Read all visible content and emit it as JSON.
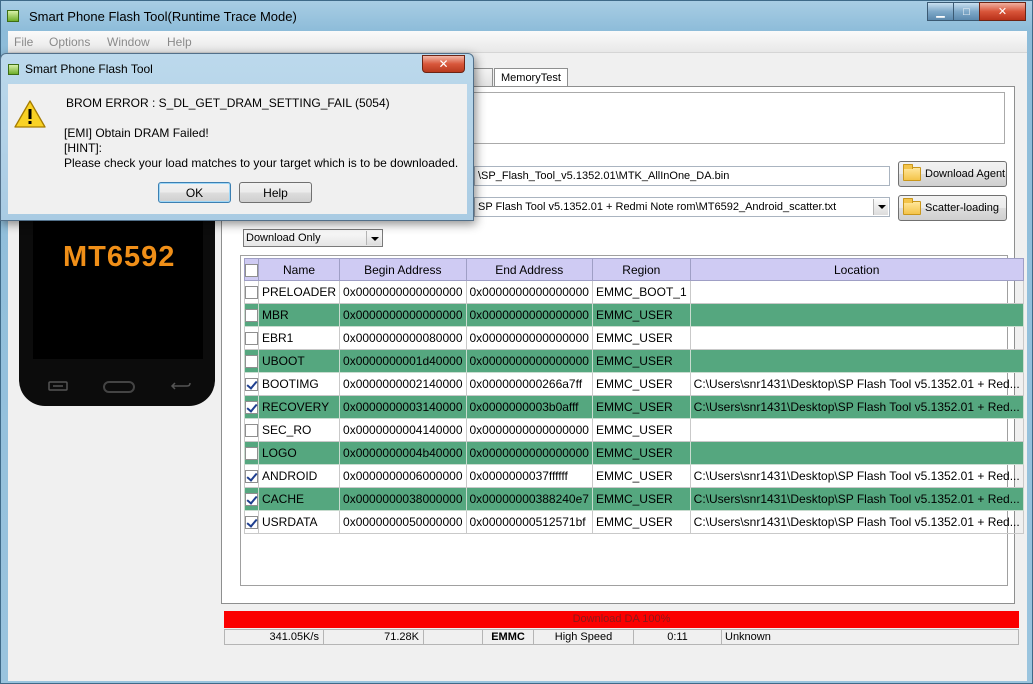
{
  "app": {
    "title": "Smart Phone Flash Tool(Runtime Trace Mode)"
  },
  "window_controls": {
    "minimize": "▁",
    "maximize": "□",
    "close": "✕"
  },
  "menu": [
    "File",
    "Options",
    "Window",
    "Help"
  ],
  "tabs": {
    "partial_label": "k",
    "memory_test_label": "MemoryTest"
  },
  "download": {
    "agent_path": "\\SP_Flash_Tool_v5.1352.01\\MTK_AllInOne_DA.bin",
    "scatter_path": "SP Flash Tool v5.1352.01 + Redmi Note rom\\MT6592_Android_scatter.txt",
    "download_agent_label": "Download Agent",
    "scatter_loading_label": "Scatter-loading",
    "mode": "Download Only"
  },
  "table": {
    "headers": {
      "name": "Name",
      "begin": "Begin Address",
      "end": "End Address",
      "region": "Region",
      "location": "Location"
    },
    "rows": [
      {
        "checked": false,
        "name": "PRELOADER",
        "begin": "0x0000000000000000",
        "end": "0x0000000000000000",
        "region": "EMMC_BOOT_1",
        "location": ""
      },
      {
        "checked": false,
        "name": "MBR",
        "begin": "0x0000000000000000",
        "end": "0x0000000000000000",
        "region": "EMMC_USER",
        "location": ""
      },
      {
        "checked": false,
        "name": "EBR1",
        "begin": "0x0000000000080000",
        "end": "0x0000000000000000",
        "region": "EMMC_USER",
        "location": ""
      },
      {
        "checked": false,
        "name": "UBOOT",
        "begin": "0x0000000001d40000",
        "end": "0x0000000000000000",
        "region": "EMMC_USER",
        "location": ""
      },
      {
        "checked": true,
        "name": "BOOTIMG",
        "begin": "0x0000000002140000",
        "end": "0x000000000266a7ff",
        "region": "EMMC_USER",
        "location": "C:\\Users\\snr1431\\Desktop\\SP Flash Tool v5.1352.01 + Red..."
      },
      {
        "checked": true,
        "name": "RECOVERY",
        "begin": "0x0000000003140000",
        "end": "0x0000000003b0afff",
        "region": "EMMC_USER",
        "location": "C:\\Users\\snr1431\\Desktop\\SP Flash Tool v5.1352.01 + Red..."
      },
      {
        "checked": false,
        "name": "SEC_RO",
        "begin": "0x0000000004140000",
        "end": "0x0000000000000000",
        "region": "EMMC_USER",
        "location": ""
      },
      {
        "checked": false,
        "name": "LOGO",
        "begin": "0x0000000004b40000",
        "end": "0x0000000000000000",
        "region": "EMMC_USER",
        "location": ""
      },
      {
        "checked": true,
        "name": "ANDROID",
        "begin": "0x0000000006000000",
        "end": "0x0000000037ffffff",
        "region": "EMMC_USER",
        "location": "C:\\Users\\snr1431\\Desktop\\SP Flash Tool v5.1352.01 + Red..."
      },
      {
        "checked": true,
        "name": "CACHE",
        "begin": "0x0000000038000000",
        "end": "0x00000000388240e7",
        "region": "EMMC_USER",
        "location": "C:\\Users\\snr1431\\Desktop\\SP Flash Tool v5.1352.01 + Red..."
      },
      {
        "checked": true,
        "name": "USRDATA",
        "begin": "0x0000000050000000",
        "end": "0x00000000512571bf",
        "region": "EMMC_USER",
        "location": "C:\\Users\\snr1431\\Desktop\\SP Flash Tool v5.1352.01 + Red..."
      }
    ]
  },
  "phone": {
    "model": "MT6592"
  },
  "progress": {
    "label": "Download DA 100%",
    "percent": 100,
    "color": "#fb0000"
  },
  "status": {
    "speed": "341.05K/s",
    "size": "71.28K",
    "storage": "EMMC",
    "usb_speed": "High Speed",
    "time": "0:11",
    "state": "Unknown"
  },
  "dialog": {
    "title": "Smart Phone Flash Tool",
    "close": "✕",
    "error": "BROM ERROR : S_DL_GET_DRAM_SETTING_FAIL (5054)",
    "line1": "[EMI] Obtain DRAM Failed!",
    "line2": "[HINT]:",
    "line3": "Please check your load matches to your target which is to be downloaded.",
    "ok_label": "OK",
    "help_label": "Help"
  }
}
